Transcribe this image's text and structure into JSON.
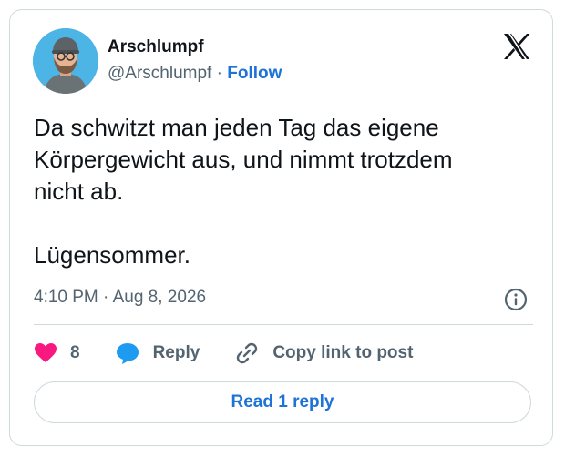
{
  "author": {
    "name": "Arschlumpf",
    "handle": "@Arschlumpf",
    "separator": "·",
    "follow_label": "Follow"
  },
  "brand": {
    "icon": "x-logo-icon"
  },
  "tweet": {
    "text": "Da schwitzt man jeden Tag das eigene\nKörpergewicht aus, und nimmt trotzdem\nnicht ab.\n\nLügensommer.",
    "timestamp": "4:10 PM · Aug 8, 2026"
  },
  "actions": {
    "like_count": "8",
    "reply_label": "Reply",
    "copy_label": "Copy link to post"
  },
  "read_replies_label": "Read 1 reply",
  "colors": {
    "accent": "#1d73d6",
    "like": "#f91880",
    "reply_icon": "#1d9bf0",
    "avatar_bg": "#4db4e6",
    "muted": "#536471"
  }
}
